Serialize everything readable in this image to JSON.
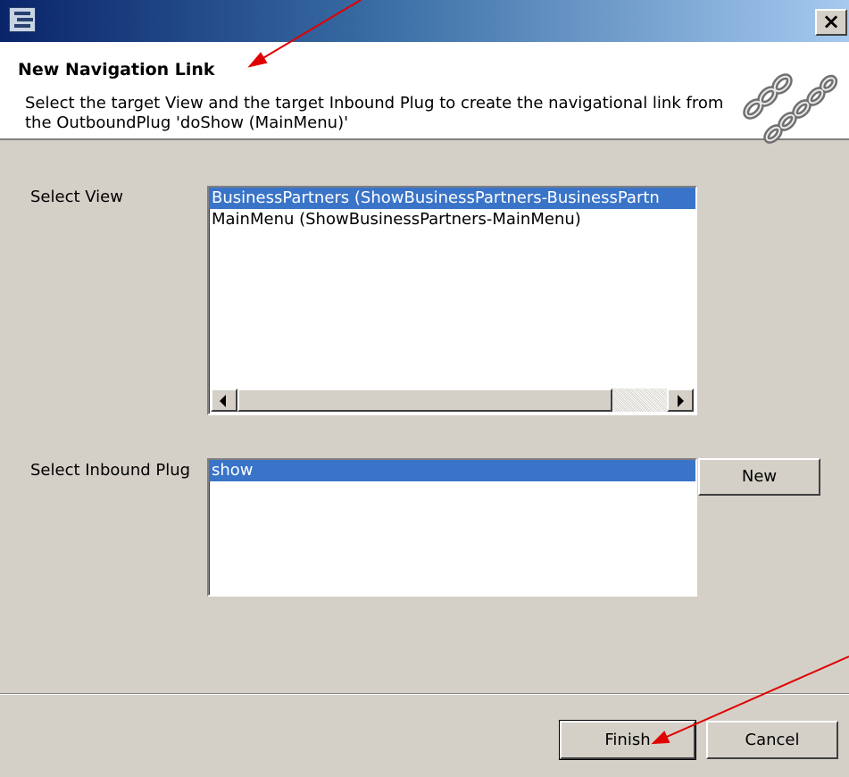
{
  "window": {
    "title": "",
    "app_icon": "application-icon",
    "close_label": "×"
  },
  "header": {
    "title": "New Navigation Link",
    "description": "Select the target View and the target Inbound Plug to create the navigational link from the OutboundPlug 'doShow (MainMenu)'",
    "banner_icon": "chain-link-icon"
  },
  "view_section": {
    "label": "Select View",
    "items": [
      {
        "label": "BusinessPartners (ShowBusinessPartners-BusinessPartn",
        "selected": true
      },
      {
        "label": "MainMenu (ShowBusinessPartners-MainMenu)",
        "selected": false
      }
    ]
  },
  "plug_section": {
    "label": "Select Inbound Plug",
    "items": [
      {
        "label": "show",
        "selected": true
      }
    ],
    "new_button": "New"
  },
  "footer": {
    "finish_button": "Finish",
    "cancel_button": "Cancel"
  },
  "annotations": {
    "arrow_color": "#e00000"
  },
  "colors": {
    "selection": "#3a74c8",
    "dialog_bg": "#d4d0c8",
    "title_gradient_start": "#0a246a",
    "title_gradient_end": "#a6caf0"
  }
}
